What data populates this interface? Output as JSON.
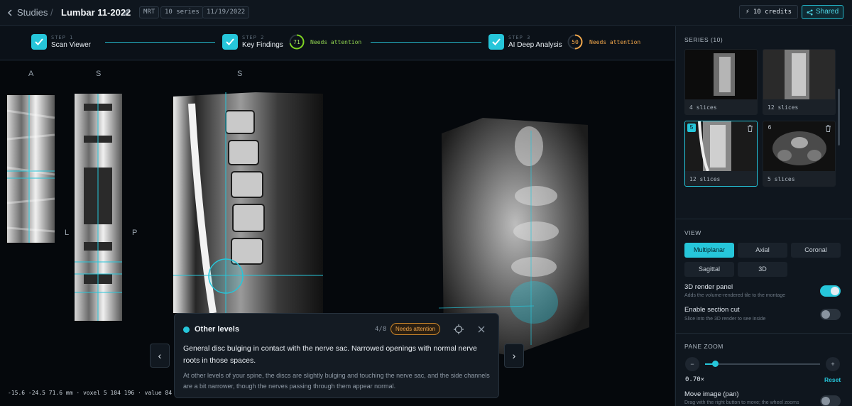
{
  "topbar": {
    "back_label": "Studies",
    "study_title": "Lumbar 11-2022",
    "modality": "MRT",
    "series_count": "10 series",
    "date": "11/19/2022",
    "credits": "10 credits",
    "shared_label": "Shared"
  },
  "stepper": {
    "steps": [
      {
        "num": "STEP 1",
        "name": "Scan Viewer"
      },
      {
        "num": "STEP 2",
        "name": "Key Findings",
        "score": "71",
        "status": "Needs attention"
      },
      {
        "num": "STEP 3",
        "name": "AI Deep Analysis",
        "score": "50",
        "status": "Needs attention"
      }
    ]
  },
  "viewer": {
    "orient": {
      "a": "A",
      "s1": "S",
      "s2": "S",
      "l": "L",
      "p": "P"
    },
    "coords": "-15.6 -24.5 71.6 mm · voxel 5 104 196 · value 84"
  },
  "finding": {
    "title": "Other levels",
    "count": "4/8",
    "badge": "Needs attention",
    "main": "General disc bulging in contact with the nerve sac. Narrowed openings with normal nerve roots in those spaces.",
    "sub": "At other levels of your spine, the discs are slightly bulging and touching the nerve sac, and the side channels are a bit narrower, though the nerves passing through them appear normal."
  },
  "sidebar": {
    "series_title": "SERIES (10)",
    "thumbs": [
      {
        "label": "4 slices"
      },
      {
        "label": "12 slices"
      },
      {
        "label": "12 slices",
        "num": "5"
      },
      {
        "label": "5 slices",
        "num": "6"
      }
    ],
    "view_title": "VIEW",
    "view_buttons": [
      "Multiplanar",
      "Axial",
      "Coronal",
      "Sagittal",
      "3D"
    ],
    "render_title": "3D render panel",
    "render_sub": "Adds the volume-rendered tile to the montage",
    "render_on": true,
    "cut_title": "Enable section cut",
    "cut_sub": "Slice into the 3D render to see inside",
    "cut_on": false,
    "zoom_title": "PANE ZOOM",
    "zoom_minus": "−",
    "zoom_plus": "+",
    "zoom_value": "0.70×",
    "zoom_level": 0.07,
    "reset_label": "Reset",
    "pan_title": "Move image (pan)",
    "pan_sub": "Drag with the right button to move; the wheel zooms",
    "pan_on": false
  },
  "colors": {
    "accent": "#26c6da",
    "warning": "#f0a64a",
    "score71": "#7ed321"
  }
}
